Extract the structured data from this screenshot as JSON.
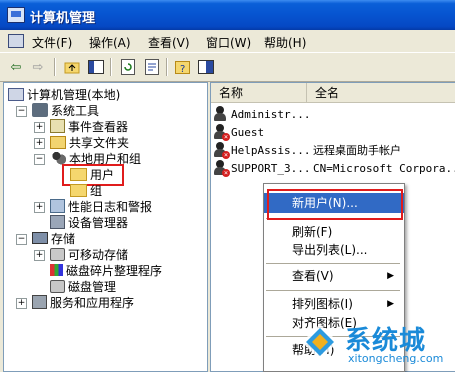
{
  "window": {
    "title": "计算机管理"
  },
  "menubar": {
    "items": [
      "文件(F)",
      "操作(A)",
      "查看(V)",
      "窗口(W)",
      "帮助(H)"
    ]
  },
  "toolbar": {
    "buttons": [
      "back",
      "forward",
      "up-folder",
      "show-hide-tree",
      "refresh",
      "export",
      "help",
      "properties"
    ]
  },
  "tree": {
    "root": "计算机管理(本地)",
    "system_tools": "系统工具",
    "event_viewer": "事件查看器",
    "shared_folders": "共享文件夹",
    "local_users": "本地用户和组",
    "users": "用户",
    "groups": "组",
    "perf_logs": "性能日志和警报",
    "device_manager": "设备管理器",
    "storage": "存储",
    "removable": "可移动存储",
    "defrag": "磁盘碎片整理程序",
    "disk_mgmt": "磁盘管理",
    "services": "服务和应用程序"
  },
  "list": {
    "columns": [
      "名称",
      "全名"
    ],
    "rows": [
      {
        "name": "Administr...",
        "fullname": "",
        "disabled": false
      },
      {
        "name": "Guest",
        "fullname": "",
        "disabled": true
      },
      {
        "name": "HelpAssis...",
        "fullname": "远程桌面助手帐户",
        "disabled": true
      },
      {
        "name": "SUPPORT_3...",
        "fullname": "CN=Microsoft Corpora...",
        "disabled": true
      }
    ]
  },
  "context_menu": {
    "new_user": "新用户(N)...",
    "refresh": "刷新(F)",
    "export": "导出列表(L)...",
    "view": "查看(V)",
    "arrange": "排列图标(I)",
    "align": "对齐图标(E)",
    "help": "帮助(H)"
  },
  "watermark": {
    "brand": "系统城",
    "url": "xitongcheng.com"
  },
  "colors": {
    "title_blue": "#0654d0",
    "highlight_red": "#e01c1c",
    "menu_select": "#316ac5"
  }
}
